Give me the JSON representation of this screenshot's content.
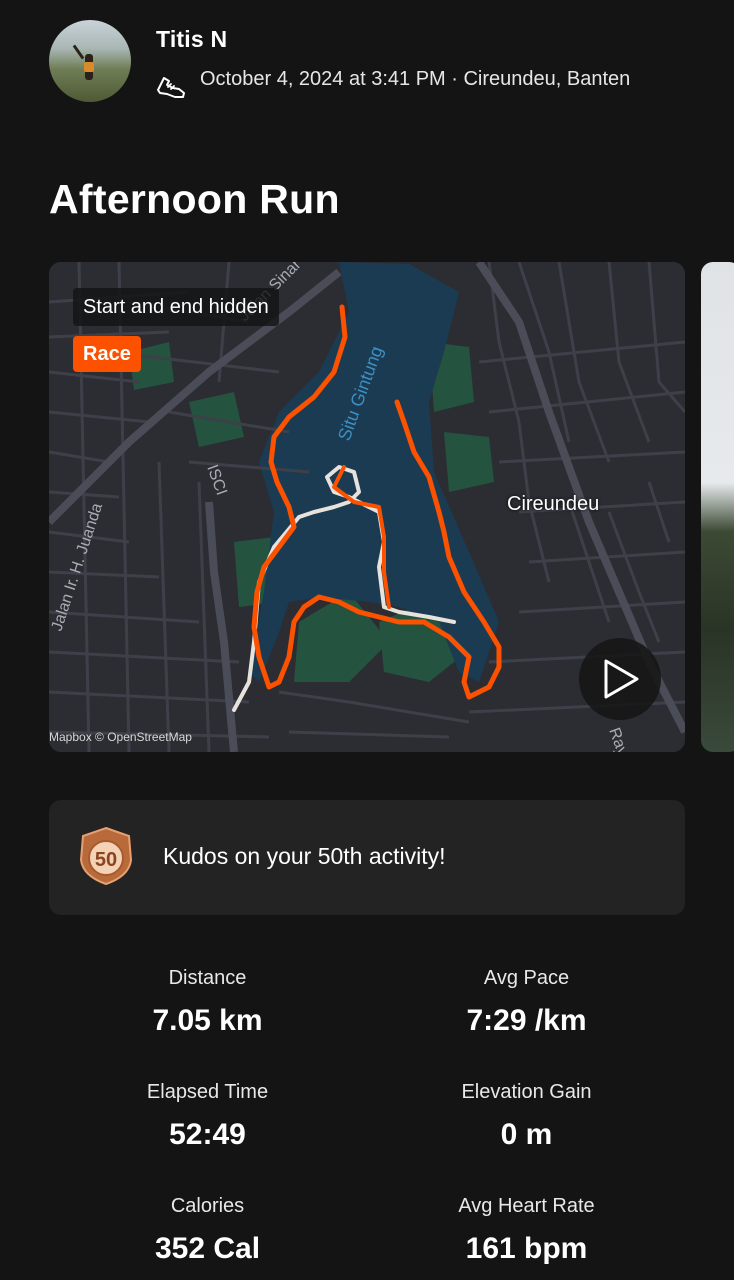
{
  "header": {
    "user_name": "Titis N",
    "meta": "October 4, 2024 at 3:41 PM · Cireundeu, Banten",
    "activity_icon": "shoe-icon"
  },
  "activity": {
    "title": "Afternoon Run"
  },
  "map": {
    "hidden_label": "Start and end hidden",
    "race_label": "Race",
    "place_label": "Cireundeu",
    "lake_label": "Situ Gintung",
    "road_labels": [
      "Jalan Ir. H. Juanda",
      "ISCI",
      "Jalan Sinar",
      "Raya"
    ],
    "credit": "Mapbox © OpenStreetMap",
    "play_icon": "play-icon",
    "route_color": "#fc5200"
  },
  "kudos": {
    "badge_number": "50",
    "text": "Kudos on your 50th activity!"
  },
  "stats": [
    {
      "label": "Distance",
      "value": "7.05 km"
    },
    {
      "label": "Avg Pace",
      "value": "7:29 /km"
    },
    {
      "label": "Elapsed Time",
      "value": "52:49"
    },
    {
      "label": "Elevation Gain",
      "value": "0 m"
    },
    {
      "label": "Calories",
      "value": "352 Cal"
    },
    {
      "label": "Avg Heart Rate",
      "value": "161 bpm"
    }
  ]
}
